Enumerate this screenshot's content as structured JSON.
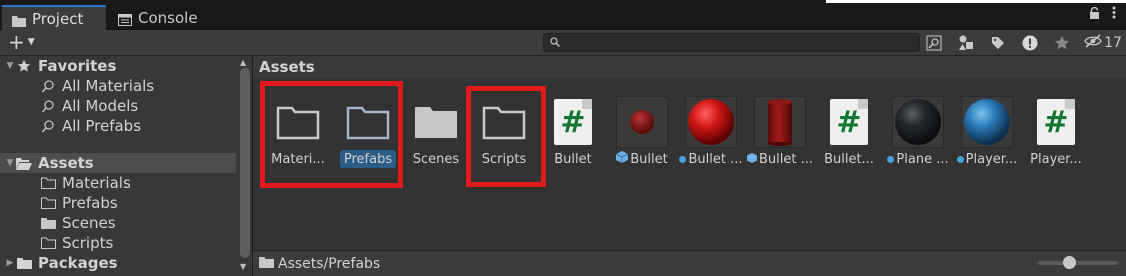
{
  "tabs": {
    "project_label": "Project",
    "console_label": "Console"
  },
  "toolbar": {
    "create_symbol": "+",
    "search_placeholder": "",
    "hidden_count": "17"
  },
  "tree": {
    "favorites_label": "Favorites",
    "favorites_items": [
      "All Materials",
      "All Models",
      "All Prefabs"
    ],
    "assets_label": "Assets",
    "assets_items": [
      "Materials",
      "Prefabs",
      "Scenes",
      "Scripts"
    ],
    "packages_label": "Packages"
  },
  "content": {
    "header": "Assets",
    "footer_path": "Assets/Prefabs",
    "assets": [
      {
        "label": "Materi...",
        "kind": "folder-empty"
      },
      {
        "label": "Prefabs",
        "kind": "folder-empty",
        "selected": true
      },
      {
        "label": "Scenes",
        "kind": "folder-filled"
      },
      {
        "label": "Scripts",
        "kind": "folder-empty"
      },
      {
        "label": "Bullet",
        "kind": "script"
      },
      {
        "label": "Bullet",
        "kind": "prefab-sphere-small"
      },
      {
        "label": "Bullet ...",
        "kind": "material-red-sphere"
      },
      {
        "label": "Bullet ...",
        "kind": "mesh-red-cylinder"
      },
      {
        "label": "Bullet...",
        "kind": "script"
      },
      {
        "label": "Plane ...",
        "kind": "material-black-sphere"
      },
      {
        "label": "Player...",
        "kind": "material-blue-sphere"
      },
      {
        "label": "Player...",
        "kind": "script"
      }
    ]
  },
  "colors": {
    "accent_blue": "#2d73c9",
    "highlight_red": "#e11b1b",
    "script_green": "#137531"
  }
}
